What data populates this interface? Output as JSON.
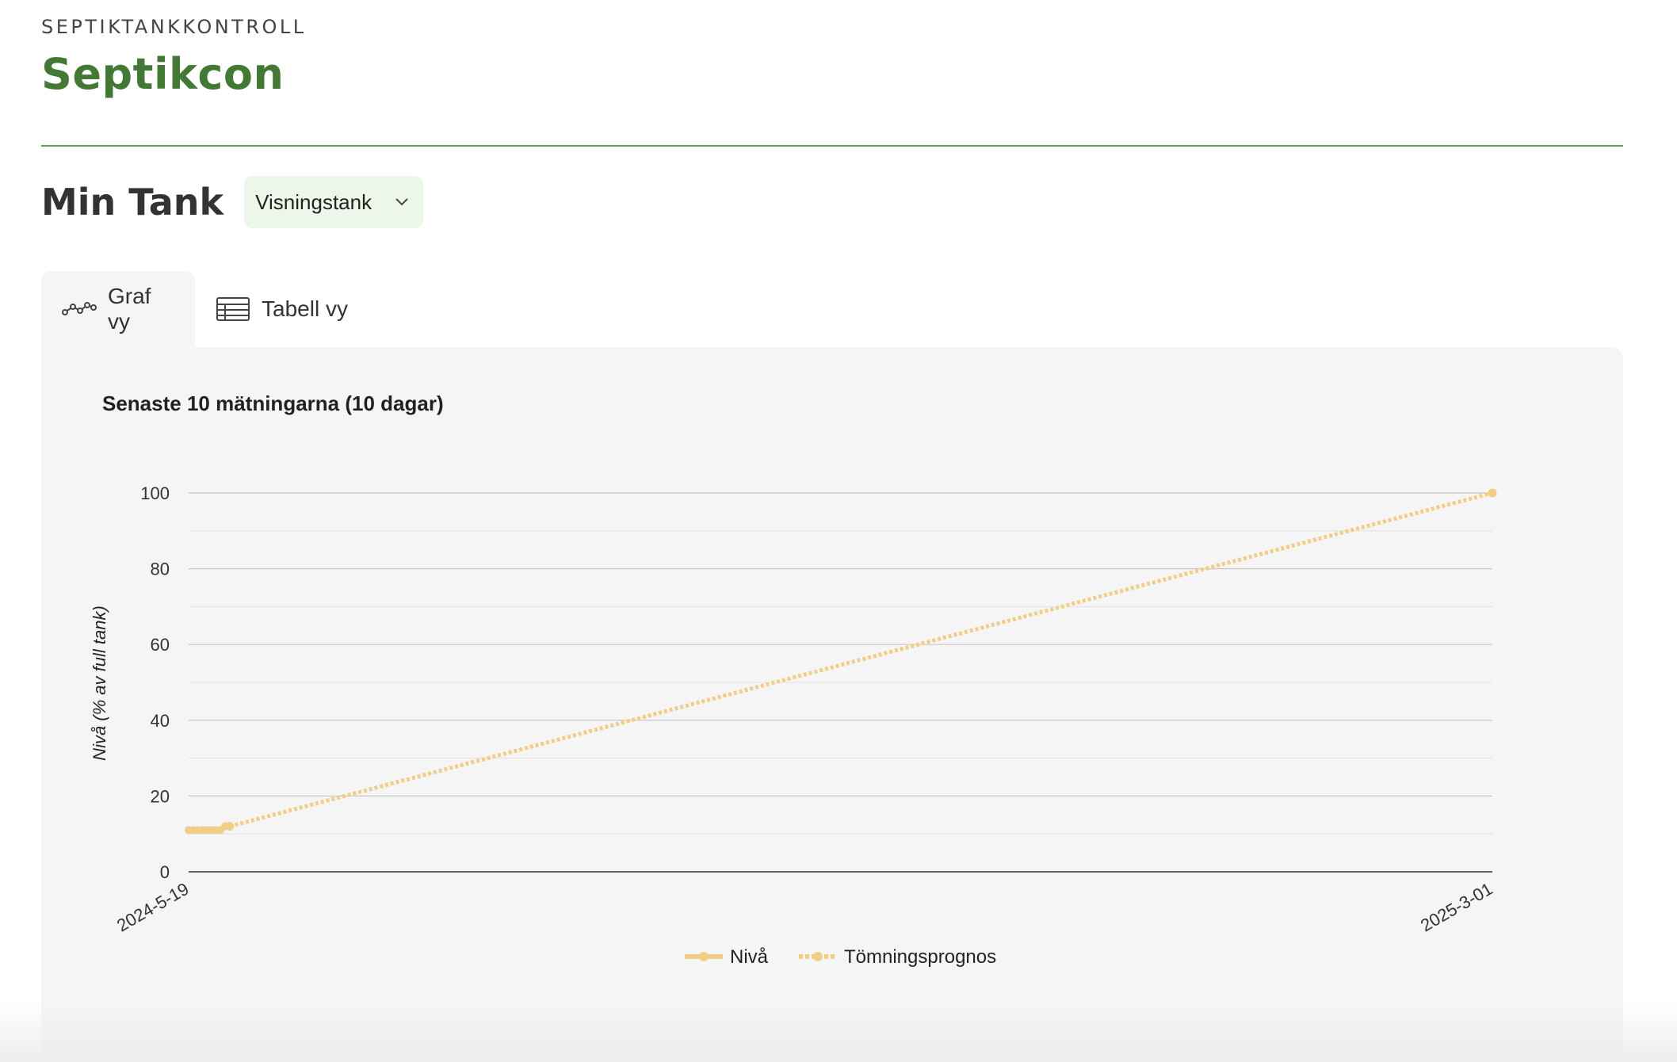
{
  "header": {
    "eyebrow": "SEPTIKTANKKONTROLL",
    "brand": "Septikcon"
  },
  "tank": {
    "title": "Min Tank",
    "selected": "Visningstank",
    "select_icon": "chevron-down-icon"
  },
  "tabs": [
    {
      "label": "Graf vy",
      "icon": "line-chart-icon",
      "active": true
    },
    {
      "label": "Tabell vy",
      "icon": "table-icon",
      "active": false
    }
  ],
  "colors": {
    "brand": "#427a35",
    "series": "#f2cd88",
    "panel": "#f5f5f5",
    "select_bg": "#ecf7ea"
  },
  "chart_data": {
    "type": "line",
    "title": "Senaste 10 mätningarna (10 dagar)",
    "ylabel": "Nivå (% av full tank)",
    "xlabel": "",
    "ylim": [
      0,
      100
    ],
    "yticks": [
      0,
      20,
      40,
      60,
      80,
      100
    ],
    "x_tick_labels": [
      "2024-5-19",
      "2025-3-01"
    ],
    "xlim": [
      "2024-05-19",
      "2025-03-01"
    ],
    "grid": true,
    "legend_position": "bottom",
    "series": [
      {
        "name": "Nivå",
        "style": "solid",
        "x": [
          "2024-05-19",
          "2024-05-20",
          "2024-05-21",
          "2024-05-22",
          "2024-05-23",
          "2024-05-24",
          "2024-05-25",
          "2024-05-26",
          "2024-05-27",
          "2024-05-28"
        ],
        "y": [
          11,
          11,
          11,
          11,
          11,
          11,
          11,
          11,
          12,
          12
        ]
      },
      {
        "name": "Tömningsprognos",
        "style": "dashed",
        "x": [
          "2024-05-28",
          "2025-03-01"
        ],
        "y": [
          12,
          100
        ]
      }
    ]
  }
}
